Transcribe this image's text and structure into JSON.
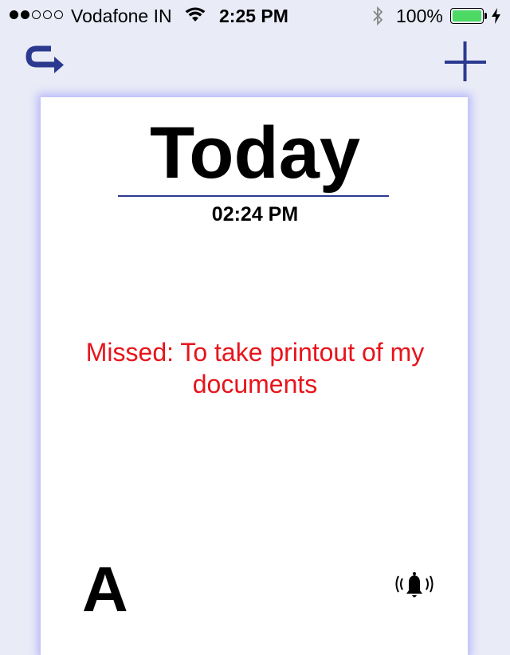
{
  "status_bar": {
    "carrier": "Vodafone IN",
    "time": "2:25 PM",
    "battery": "100%",
    "signal_bars_filled": 2,
    "signal_bars_total": 5,
    "battery_level": 1.0,
    "battery_color": "#4cd964"
  },
  "nav": {
    "left_icon": "loop-back-icon",
    "right_icon": "add-icon",
    "accent_color": "#2b3a8f"
  },
  "card": {
    "title": "Today",
    "time": "02:24 PM",
    "message": "Missed: To take printout of my documents",
    "message_color": "#e8141b",
    "font_button": "A",
    "alarm_icon": "bell-ringing-icon"
  }
}
